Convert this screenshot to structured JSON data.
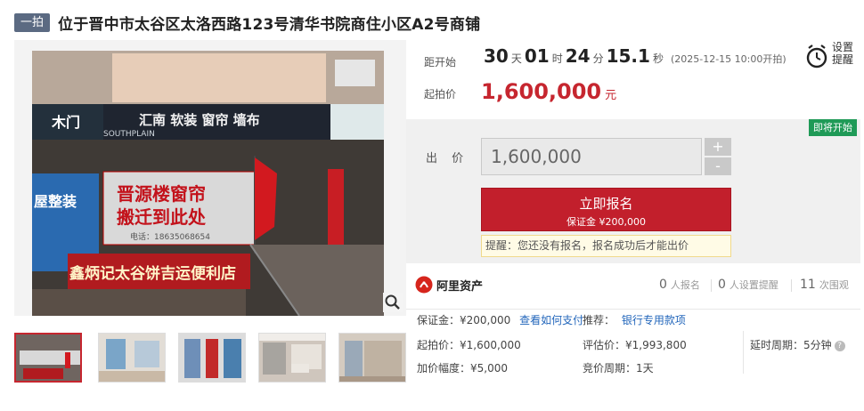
{
  "header": {
    "round_tag": "一拍",
    "title": "位于晋中市太谷区太洛西路123号清华书院商住小区A2号商铺"
  },
  "gallery": {
    "main_photo_signs": {
      "shop_left": "木门",
      "brand": "汇南 软装 窗帘 墙布",
      "brand_en": "SOUTHPLAIN",
      "banner_line1": "晋源楼窗帘",
      "banner_line2": "搬迁到此处",
      "phone": "电话：18635068654",
      "lower_sign": "鑫炳记太谷饼吉运便利店",
      "side_sign": "屋整装"
    },
    "thumbnail_count": 5,
    "active_thumbnail": 1
  },
  "countdown": {
    "label": "距开始",
    "days": "30",
    "days_unit": "天",
    "hours": "01",
    "hours_unit": "时",
    "minutes": "24",
    "minutes_unit": "分",
    "seconds": "15.1",
    "seconds_unit": "秒",
    "start_note": "(2025-12-15 10:00开拍)"
  },
  "reminder": {
    "line1": "设置",
    "line2": "提醒"
  },
  "start_price": {
    "label": "起拍价",
    "value": "1,600,000",
    "unit": "元"
  },
  "bid": {
    "badge": "即将开始",
    "label": "出 价",
    "input_value": "1,600,000",
    "plus": "+",
    "minus": "-",
    "register_label": "立即报名",
    "deposit_note": "保证金 ¥200,000",
    "hint": "提醒：您还没有报名，报名成功后才能出价"
  },
  "stats": {
    "brand": "阿里资产",
    "registered_count": "0",
    "registered_label": "人报名",
    "reminder_count": "0",
    "reminder_label": "人设置提醒",
    "views_count": "11",
    "views_label": "次围观"
  },
  "details": {
    "deposit": "保证金：¥200,000",
    "how_to_pay": "查看如何支付",
    "recommend_label": "推荐：",
    "recommend_value": "银行专用款项",
    "start_price": "起拍价：¥1,600,000",
    "appraisal": "评估价：¥1,993,800",
    "delay_period": "延时周期：5分钟",
    "increment": "加价幅度：¥5,000",
    "bid_period": "竞价周期：1天"
  },
  "colors": {
    "accent_red": "#c21f2c",
    "badge_green": "#1f9a57",
    "link_blue": "#2266bb",
    "tag_gray": "#5b6a82"
  }
}
